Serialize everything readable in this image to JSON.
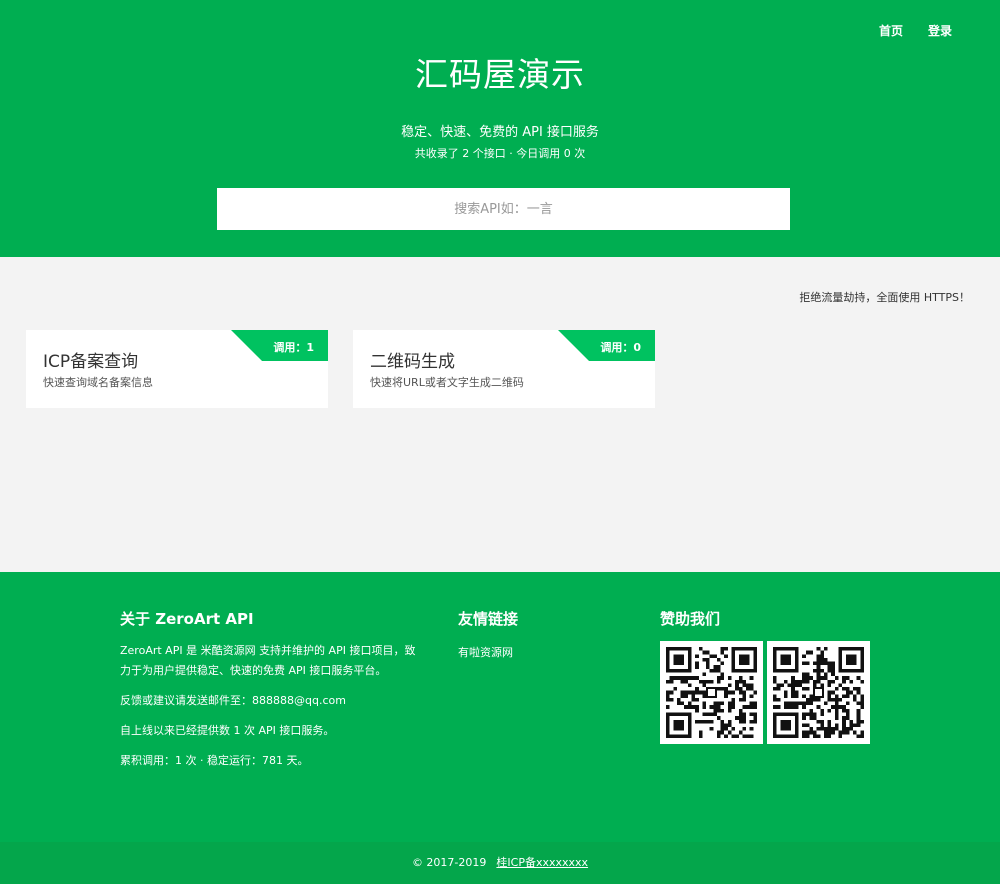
{
  "nav": {
    "items": [
      {
        "label": "首页"
      },
      {
        "label": "登录"
      }
    ]
  },
  "hero": {
    "title": "汇码屋演示",
    "subtitle": "稳定、快速、免费的 API 接口服务",
    "stats": "共收录了 2 个接口 · 今日调用 0 次"
  },
  "search": {
    "placeholder": "搜索API如：一言",
    "value": ""
  },
  "notice": "拒绝流量劫持，全面使用 HTTPS！",
  "apis": [
    {
      "count_label": "调用：1",
      "title": "ICP备案查询",
      "description": "快速查询域名备案信息"
    },
    {
      "count_label": "调用：0",
      "title": "二维码生成",
      "description": "快速将URL或者文字生成二维码"
    }
  ],
  "footer": {
    "about": {
      "heading": "关于 ZeroArt API",
      "text": "ZeroArt API 是 米酷资源网 支持并维护的 API 接口项目，致力于为用户提供稳定、快速的免费 API 接口服务平台。",
      "feedback": "反馈或建议请发送邮件至：888888@qq.com",
      "served": "自上线以来已经提供数 1 次 API 接口服务。",
      "total": "累积调用：1 次 · 稳定运行：781 天。"
    },
    "links": {
      "heading": "友情链接",
      "items": [
        {
          "label": "有啦资源网"
        }
      ]
    },
    "sponsor": {
      "heading": "赞助我们"
    }
  },
  "copyright": {
    "text": "© 2017-2019",
    "icp": "桂ICP备xxxxxxxx"
  },
  "colors": {
    "brand_green": "#00ae51",
    "ribbon_green": "#00c260",
    "background": "#f3f3f3"
  }
}
